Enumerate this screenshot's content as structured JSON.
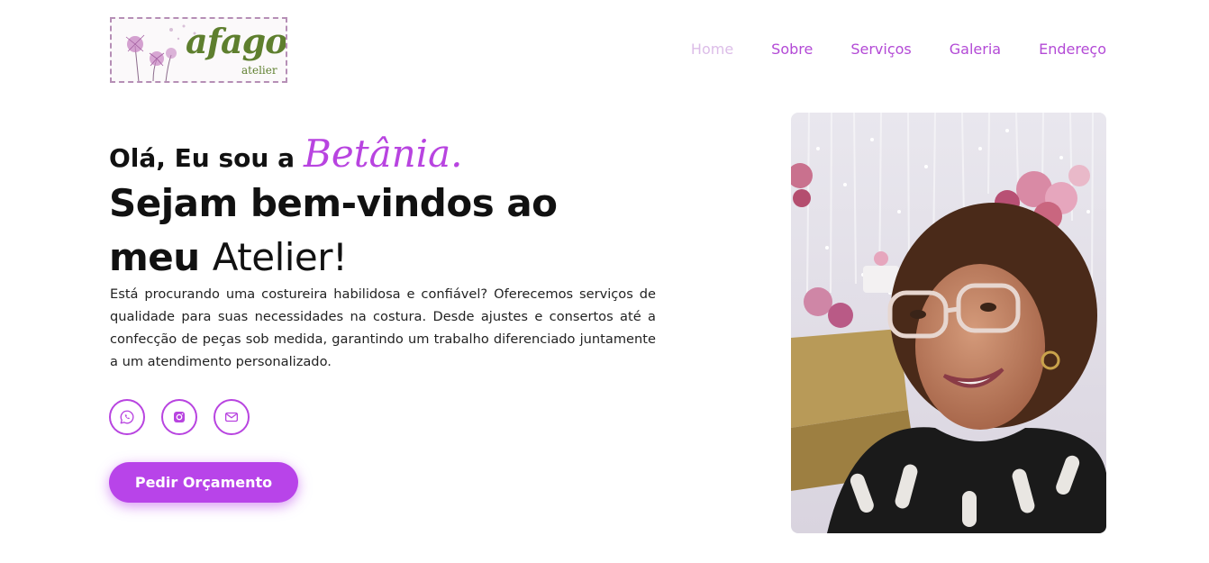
{
  "brand": {
    "logo_word": "afago",
    "logo_sub": "atelier",
    "logo_color": "#5e7f2e"
  },
  "nav": {
    "items": [
      "Home",
      "Sobre",
      "Serviços",
      "Galeria",
      "Endereço"
    ],
    "active": "Home"
  },
  "hero": {
    "greeting": "Olá, Eu sou a",
    "name": "Betânia.",
    "headline_bold_1": "Sejam bem-vindos ao",
    "headline_bold_2": "meu",
    "headline_regular": "Atelier!",
    "description": "Está procurando uma costureira habilidosa e confiável? Oferecemos serviços de qualidade para suas necessidades na costura. Desde ajustes e consertos até a confecção de peças sob medida, garantindo um trabalho diferenciado juntamente a um atendimento personalizado.",
    "cta_label": "Pedir Orçamento"
  },
  "socials": {
    "icons": [
      "whatsapp-icon",
      "instagram-icon",
      "email-icon"
    ]
  },
  "colors": {
    "accent": "#b844e0",
    "nav_active": "#dcbde8",
    "button": "#b844e9"
  }
}
